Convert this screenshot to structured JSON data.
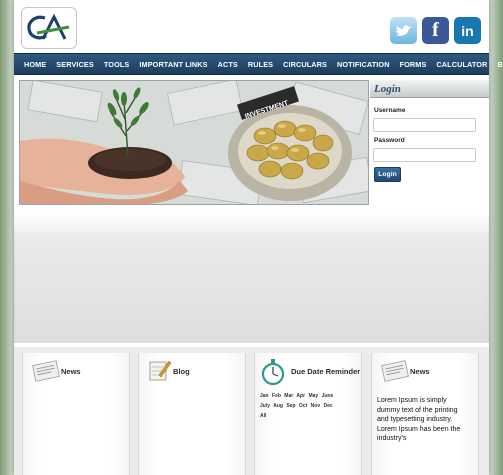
{
  "header": {
    "logo_text": "CA",
    "social": [
      {
        "name": "twitter-icon",
        "glyph": "t"
      },
      {
        "name": "facebook-icon",
        "glyph": "f"
      },
      {
        "name": "linkedin-icon",
        "glyph": "in"
      }
    ]
  },
  "nav": {
    "items": [
      "HOME",
      "SERVICES",
      "TOOLS",
      "IMPORTANT LINKS",
      "ACTS",
      "RULES",
      "CIRCULARS",
      "NOTIFICATION",
      "FORMS",
      "CALCULATOR",
      "BLOGS"
    ]
  },
  "hero": {
    "paper_label": "INVESTMENT"
  },
  "login": {
    "title": "Login",
    "username_label": "Username",
    "password_label": "Password",
    "button_label": "Login"
  },
  "boxes": {
    "news1_title": "News",
    "blog_title": "Blog",
    "due_title": "Due Date Reminder",
    "months": [
      "Jan",
      "Feb",
      "Mar",
      "Apr",
      "May",
      "June",
      "July",
      "Aug",
      "Sep",
      "Oct",
      "Nov",
      "Dec",
      "All"
    ],
    "news2_title": "News",
    "news2_text": "Lorem Ipsum is simply dummy text of the printing and typesetting industry. Lorem Ipsum has been the industry's"
  },
  "colors": {
    "nav_bg": "#2f5a83",
    "accent_green": "#3f8f3a",
    "logo_blue": "#1f3f6a"
  }
}
